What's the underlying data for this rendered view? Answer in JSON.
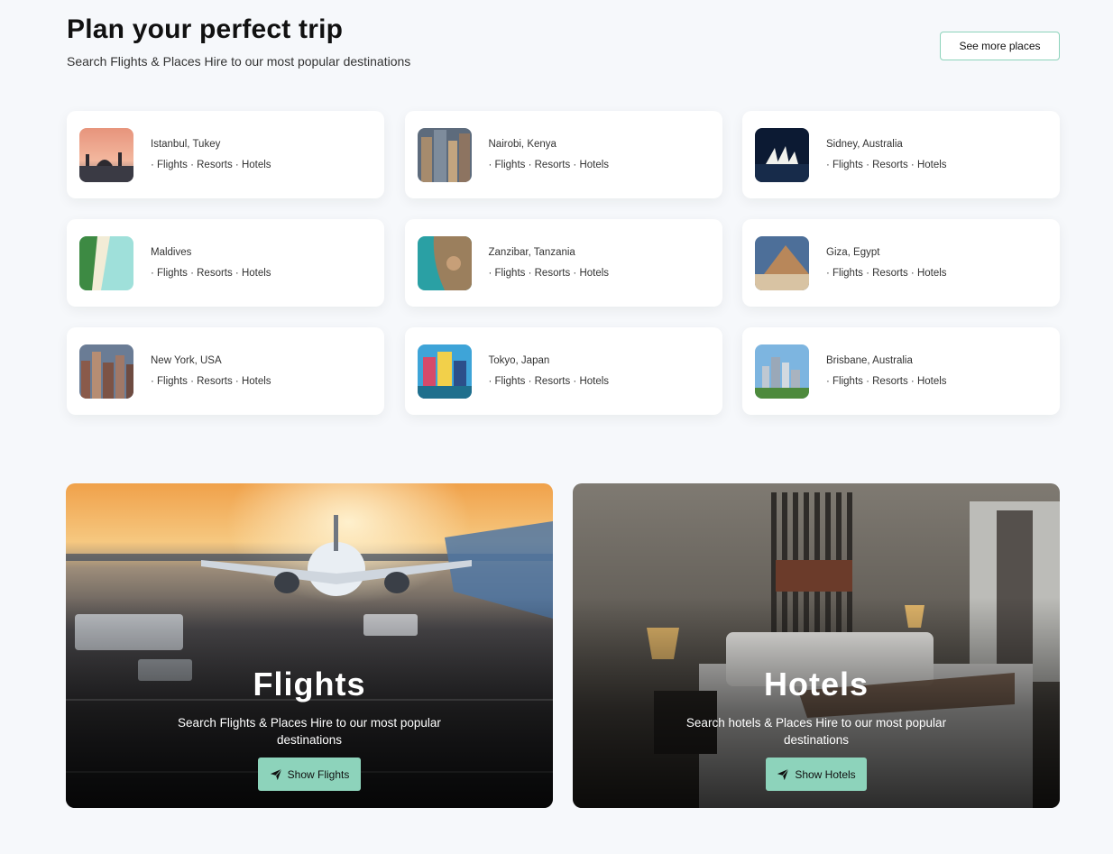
{
  "header": {
    "title": "Plan your perfect trip",
    "subtitle": "Search Flights & Places Hire to our most popular destinations",
    "see_more_label": "See more places"
  },
  "destinations": [
    {
      "place": "Istanbul, Tukey",
      "tags": "· Flights · Resorts · Hotels"
    },
    {
      "place": "Nairobi, Kenya",
      "tags": "· Flights · Resorts · Hotels"
    },
    {
      "place": "Sidney, Australia",
      "tags": "· Flights · Resorts · Hotels"
    },
    {
      "place": "Maldives",
      "tags": "· Flights · Resorts · Hotels"
    },
    {
      "place": "Zanzibar, Tanzania",
      "tags": "· Flights · Resorts · Hotels"
    },
    {
      "place": "Giza, Egypt",
      "tags": "· Flights · Resorts · Hotels"
    },
    {
      "place": "New York, USA",
      "tags": "· Flights · Resorts · Hotels"
    },
    {
      "place": "Tokyo, Japan",
      "tags": "· Flights · Resorts · Hotels"
    },
    {
      "place": "Brisbane, Australia",
      "tags": "· Flights · Resorts · Hotels"
    }
  ],
  "promos": {
    "flights": {
      "title": "Flights",
      "description": "Search Flights & Places Hire to our most popular destinations",
      "button_label": "Show Flights",
      "button_icon": "paper-plane-icon"
    },
    "hotels": {
      "title": "Hotels",
      "description": "Search hotels & Places Hire to our most popular destinations",
      "button_label": "Show Hotels",
      "button_icon": "paper-plane-icon"
    }
  },
  "colors": {
    "accent": "#8DD3BB",
    "background": "#f6f8fb",
    "card": "#ffffff"
  }
}
